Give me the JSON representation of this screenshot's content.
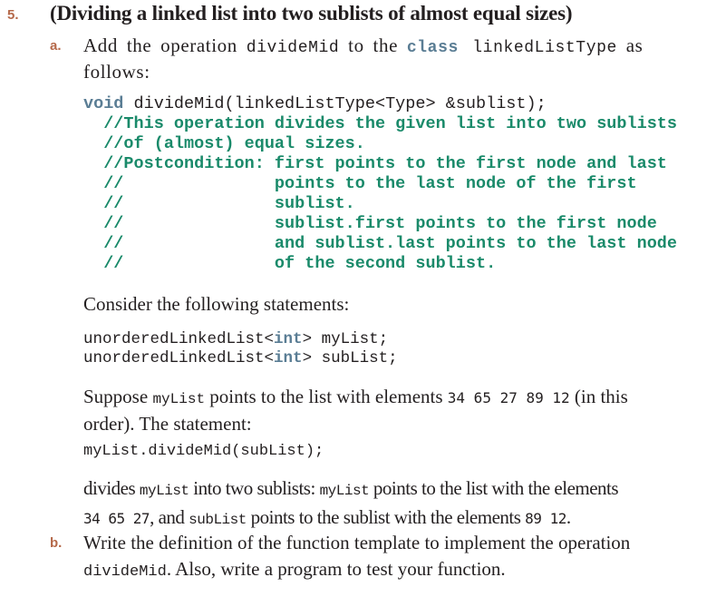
{
  "problem": {
    "number": "5.",
    "title": "(Dividing a linked list into two sublists of almost equal sizes)"
  },
  "part_a": {
    "label": "a.",
    "intro_1": "Add the operation ",
    "intro_code_1": "divideMid",
    "intro_2": " to the ",
    "intro_kw": "class",
    "intro_code_2": " linkedListType",
    "intro_3": " as",
    "intro_4": "follows:",
    "declaration": {
      "keyword": "void",
      "signature": " divideMid(linkedListType<Type> &sublist);",
      "comments": [
        "  //This operation divides the given list into two sublists",
        "  //of (almost) equal sizes.",
        "  //Postcondition: first points to the first node and last",
        "  //               points to the last node of the first",
        "  //               sublist.",
        "  //               sublist.first points to the first node",
        "  //               and sublist.last points to the last node",
        "  //               of the second sublist."
      ]
    },
    "consider_text": "Consider the following statements:",
    "statements": [
      {
        "prefix": "unorderedLinkedList<",
        "kw": "int",
        "suffix": "> myList;"
      },
      {
        "prefix": "unorderedLinkedList<",
        "kw": "int",
        "suffix": "> subList;"
      }
    ],
    "suppose_1": "Suppose ",
    "suppose_code": "myList",
    "suppose_2": " points to the list with elements ",
    "suppose_nums": "34 65 27 89 12",
    "suppose_3": " (in this",
    "suppose_4": "order). The statement:",
    "call_statement": "myList.divideMid(subList);",
    "divides_1": "divides ",
    "divides_code_1": "myList",
    "divides_2": " into two sublists: ",
    "divides_code_2": "myList",
    "divides_3": " points to the list with the elements",
    "divides_nums_1": "34 65 27",
    "divides_4": ", and ",
    "divides_code_3": "subList",
    "divides_5": " points to the sublist with the elements ",
    "divides_nums_2": "89 12",
    "divides_6": "."
  },
  "part_b": {
    "label": "b.",
    "text_1": "Write the definition of the function template to implement the operation",
    "code": "divideMid",
    "text_2": ". Also, write a program to test your function."
  }
}
